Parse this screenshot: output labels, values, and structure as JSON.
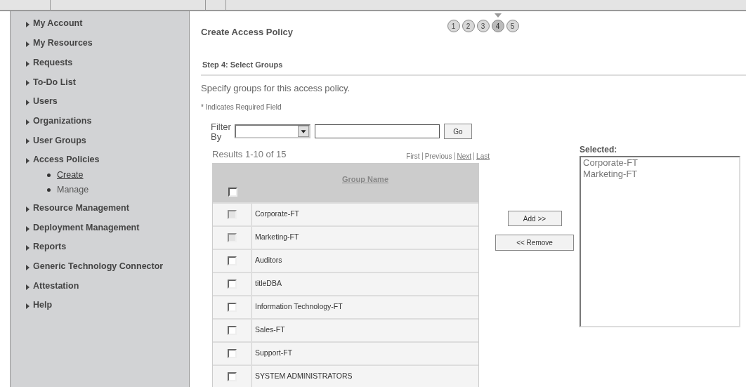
{
  "sidebar": {
    "items": [
      {
        "label": "My Account"
      },
      {
        "label": "My Resources"
      },
      {
        "label": "Requests"
      },
      {
        "label": "To-Do List"
      },
      {
        "label": "Users"
      },
      {
        "label": "Organizations"
      },
      {
        "label": "User Groups"
      },
      {
        "label": "Access Policies",
        "children": [
          {
            "label": "Create",
            "selected": true
          },
          {
            "label": "Manage",
            "selected": false
          }
        ]
      },
      {
        "label": "Resource Management"
      },
      {
        "label": "Deployment Management"
      },
      {
        "label": "Reports"
      },
      {
        "label": "Generic Technology Connector"
      },
      {
        "label": "Attestation"
      },
      {
        "label": "Help"
      }
    ]
  },
  "page_title": "Create Access Policy",
  "steps": [
    {
      "label": "1",
      "selected": false
    },
    {
      "label": "2",
      "selected": false
    },
    {
      "label": "3",
      "selected": false
    },
    {
      "label": "4",
      "selected": true
    },
    {
      "label": "5",
      "selected": false
    }
  ],
  "section_title": "Step 4: Select Groups",
  "description": "Specify groups for this access policy.",
  "required_note": "* Indicates Required Field",
  "filter": {
    "label": "Filter By",
    "go": "Go"
  },
  "results": {
    "summary": "Results 1-10 of 15",
    "pager": [
      {
        "label": "First",
        "link": false
      },
      {
        "label": "Previous",
        "link": false
      },
      {
        "label": "Next",
        "link": true
      },
      {
        "label": "Last",
        "link": true
      }
    ]
  },
  "table": {
    "column": "Group Name",
    "select_all_checked": false,
    "rows": [
      {
        "name": "Corporate-FT",
        "disabled": true
      },
      {
        "name": "Marketing-FT",
        "disabled": true
      },
      {
        "name": "Auditors",
        "disabled": false
      },
      {
        "name": "titleDBA",
        "disabled": false
      },
      {
        "name": "Information Technology-FT",
        "disabled": false
      },
      {
        "name": "Sales-FT",
        "disabled": false
      },
      {
        "name": "Support-FT",
        "disabled": false
      },
      {
        "name": "SYSTEM ADMINISTRATORS",
        "disabled": false
      }
    ]
  },
  "buttons": {
    "add": "Add >>",
    "remove": "<< Remove"
  },
  "selected_list": {
    "label": "Selected:",
    "items": [
      "Corporate-FT",
      "Marketing-FT"
    ]
  }
}
